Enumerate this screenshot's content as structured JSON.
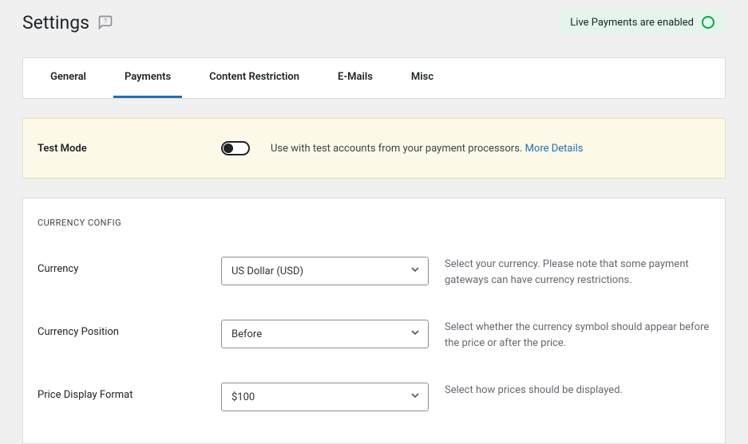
{
  "header": {
    "title": "Settings",
    "live_badge": "Live Payments are enabled"
  },
  "tabs": {
    "general": "General",
    "payments": "Payments",
    "content": "Content Restriction",
    "emails": "E-Mails",
    "misc": "Misc"
  },
  "test_mode": {
    "label": "Test Mode",
    "desc": "Use with test accounts from your payment processors. ",
    "link": "More Details"
  },
  "currency_config": {
    "heading": "CURRENCY CONFIG",
    "currency": {
      "label": "Currency",
      "value": "US Dollar (USD)",
      "help": "Select your currency. Please note that some payment gateways can have currency restrictions."
    },
    "position": {
      "label": "Currency Position",
      "value": "Before",
      "help": "Select whether the currency symbol should appear before the price or after the price."
    },
    "format": {
      "label": "Price Display Format",
      "value": "$100",
      "help": "Select how prices should be displayed."
    }
  }
}
